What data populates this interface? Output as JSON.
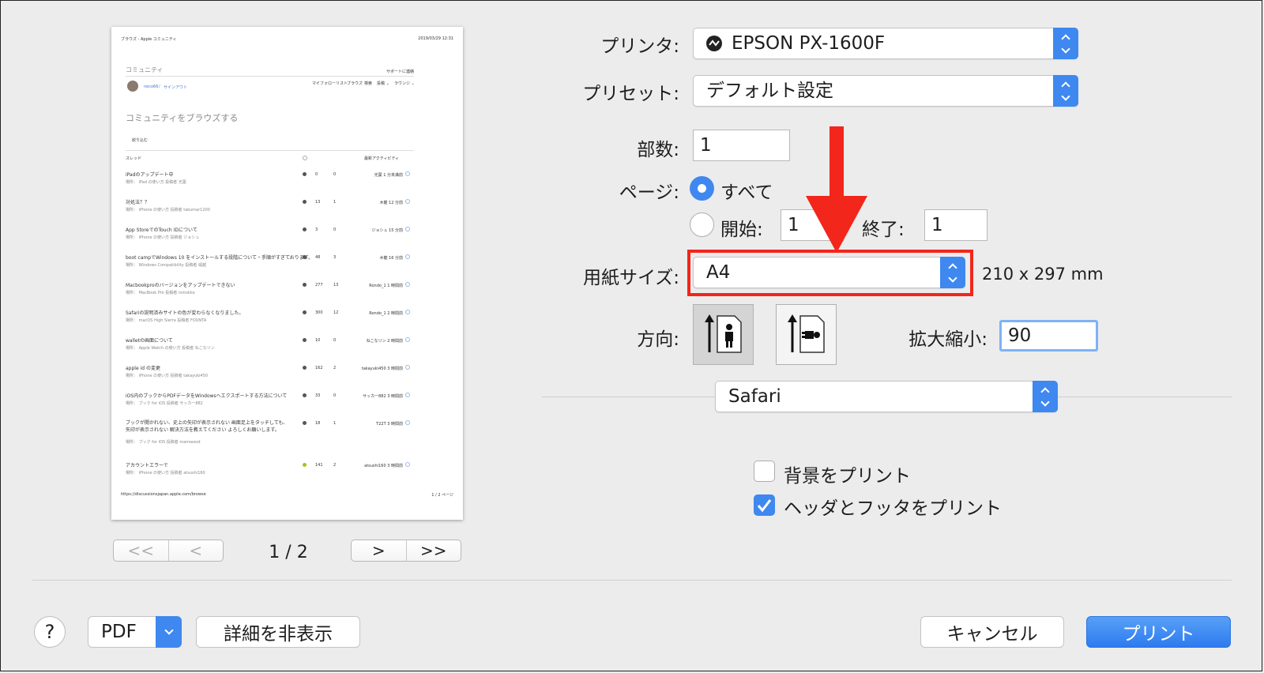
{
  "preview": {
    "header_left": "ブラウズ - Apple コミュニティ",
    "header_right": "2019/03/29 12:31",
    "community": "コミュニティ",
    "support": "サポートに連絡",
    "user": "neco66",
    "signout": "サインアウト",
    "nav": [
      "マイフォローリスト",
      "ブラウズ",
      "検索",
      "投稿 ⌄",
      "ラウンジ ⌄"
    ],
    "heading": "コミュニティをブラウズする",
    "filter": "絞り込む",
    "col_thread": "スレッド",
    "col_activity": "最新アクティビティ",
    "rows": [
      {
        "title": "iPadのアップデート中",
        "meta": "場所： iPad の使い方 投稿者 光葉",
        "c1": "0",
        "c2": "0",
        "act": "光葉 1 分未満前",
        "dot": "#555555"
      },
      {
        "title": "対処法？？",
        "meta": "場所： iPhone の使い方 投稿者 takumar1200",
        "c1": "13",
        "c2": "1",
        "act": "木龍 12 分前",
        "dot": "#555555"
      },
      {
        "title": "App StoreでのTouch IDについて",
        "meta": "場所： iPhone の使い方 投稿者 ジョシュ",
        "c1": "3",
        "c2": "0",
        "act": "ジョシュ 15 分前",
        "dot": "#555555"
      },
      {
        "title": "boot campでWindows 10 をインストールする段階について・手順がすぎております。",
        "meta": "場所： Windows Compatibility 投稿者 堀越",
        "c1": "48",
        "c2": "3",
        "act": "木龍 16 分前",
        "dot": "#555555"
      },
      {
        "title": "Macbookproのバージョンをアップデートできない",
        "meta": "場所： MacBook Pro 投稿者 rsmskko",
        "c1": "277",
        "c2": "13",
        "act": "Rondo_1 1 時間前",
        "dot": "#555555"
      },
      {
        "title": "Safariの説明済みサイトの色が変わらなくなりました。",
        "meta": "場所： macOS High Sierra 投稿者 FOUNTA",
        "c1": "300",
        "c2": "12",
        "act": "Rondo_1 2 時間前",
        "dot": "#555555"
      },
      {
        "title": "walletの画面について",
        "meta": "場所： Apple Watch の使い方 投稿者 ねこなリン",
        "c1": "10",
        "c2": "0",
        "act": "ねこなリン 2 時間前",
        "dot": "#555555"
      },
      {
        "title": "apple id の変更",
        "meta": "場所： iPhone の使い方 投稿者 takayuki450",
        "c1": "162",
        "c2": "2",
        "act": "takayuki450 3 時間前",
        "dot": "#555555"
      },
      {
        "title": "iOS内のブックからPDFデータをWindowsへエクスポートする方法について",
        "meta": "場所： ブック for iOS 投稿者 サッカー882",
        "c1": "33",
        "c2": "0",
        "act": "サッカー882 3 時間前",
        "dot": "#555555"
      },
      {
        "title": "ブックが開かれない、史上の矢印が表示されない 画面足上をタッチしても、矢印が表示されない 解決方法を教えてください よろしくお願いします。",
        "meta": "場所： ブック for iOS 投稿者 mamwood",
        "c1": "18",
        "c2": "1",
        "act": "T22T 3 時間前",
        "dot": "#555555"
      },
      {
        "title": "アカウントエラーで",
        "meta": "場所： iPhone の使い方 投稿者 atsushi160",
        "c1": "141",
        "c2": "2",
        "act": "atsushi160 3 時間前",
        "dot": "#a5c21f"
      }
    ],
    "footer_url": "https://discussionsjapan.apple.com/browse",
    "footer_page": "1 / 2 ページ"
  },
  "pager": {
    "first": "<<",
    "prev": "<",
    "indicator": "1 / 2",
    "next": ">",
    "last": ">>"
  },
  "printer": {
    "label": "プリンタ:",
    "value": "EPSON PX-1600F"
  },
  "preset": {
    "label": "プリセット:",
    "value": "デフォルト設定"
  },
  "copies": {
    "label": "部数:",
    "value": "1"
  },
  "pages": {
    "label": "ページ:",
    "all": "すべて",
    "from_label": "開始:",
    "from": "1",
    "to_label": "終了:",
    "to": "1",
    "selected": "all"
  },
  "paper": {
    "label": "用紙サイズ:",
    "value": "A4",
    "dimensions": "210 x 297 mm"
  },
  "orientation": {
    "label": "方向:",
    "selected": "portrait"
  },
  "scale": {
    "label": "拡大縮小:",
    "value": "90"
  },
  "app_menu": {
    "value": "Safari"
  },
  "options": {
    "background": {
      "label": "背景をプリント",
      "checked": false
    },
    "header_footer": {
      "label": "ヘッダとフッタをプリント",
      "checked": true
    }
  },
  "bottom": {
    "help": "?",
    "pdf": "PDF",
    "details": "詳細を非表示",
    "cancel": "キャンセル",
    "print": "プリント"
  },
  "colors": {
    "accent": "#3e88f0",
    "highlight": "#f2261b"
  }
}
